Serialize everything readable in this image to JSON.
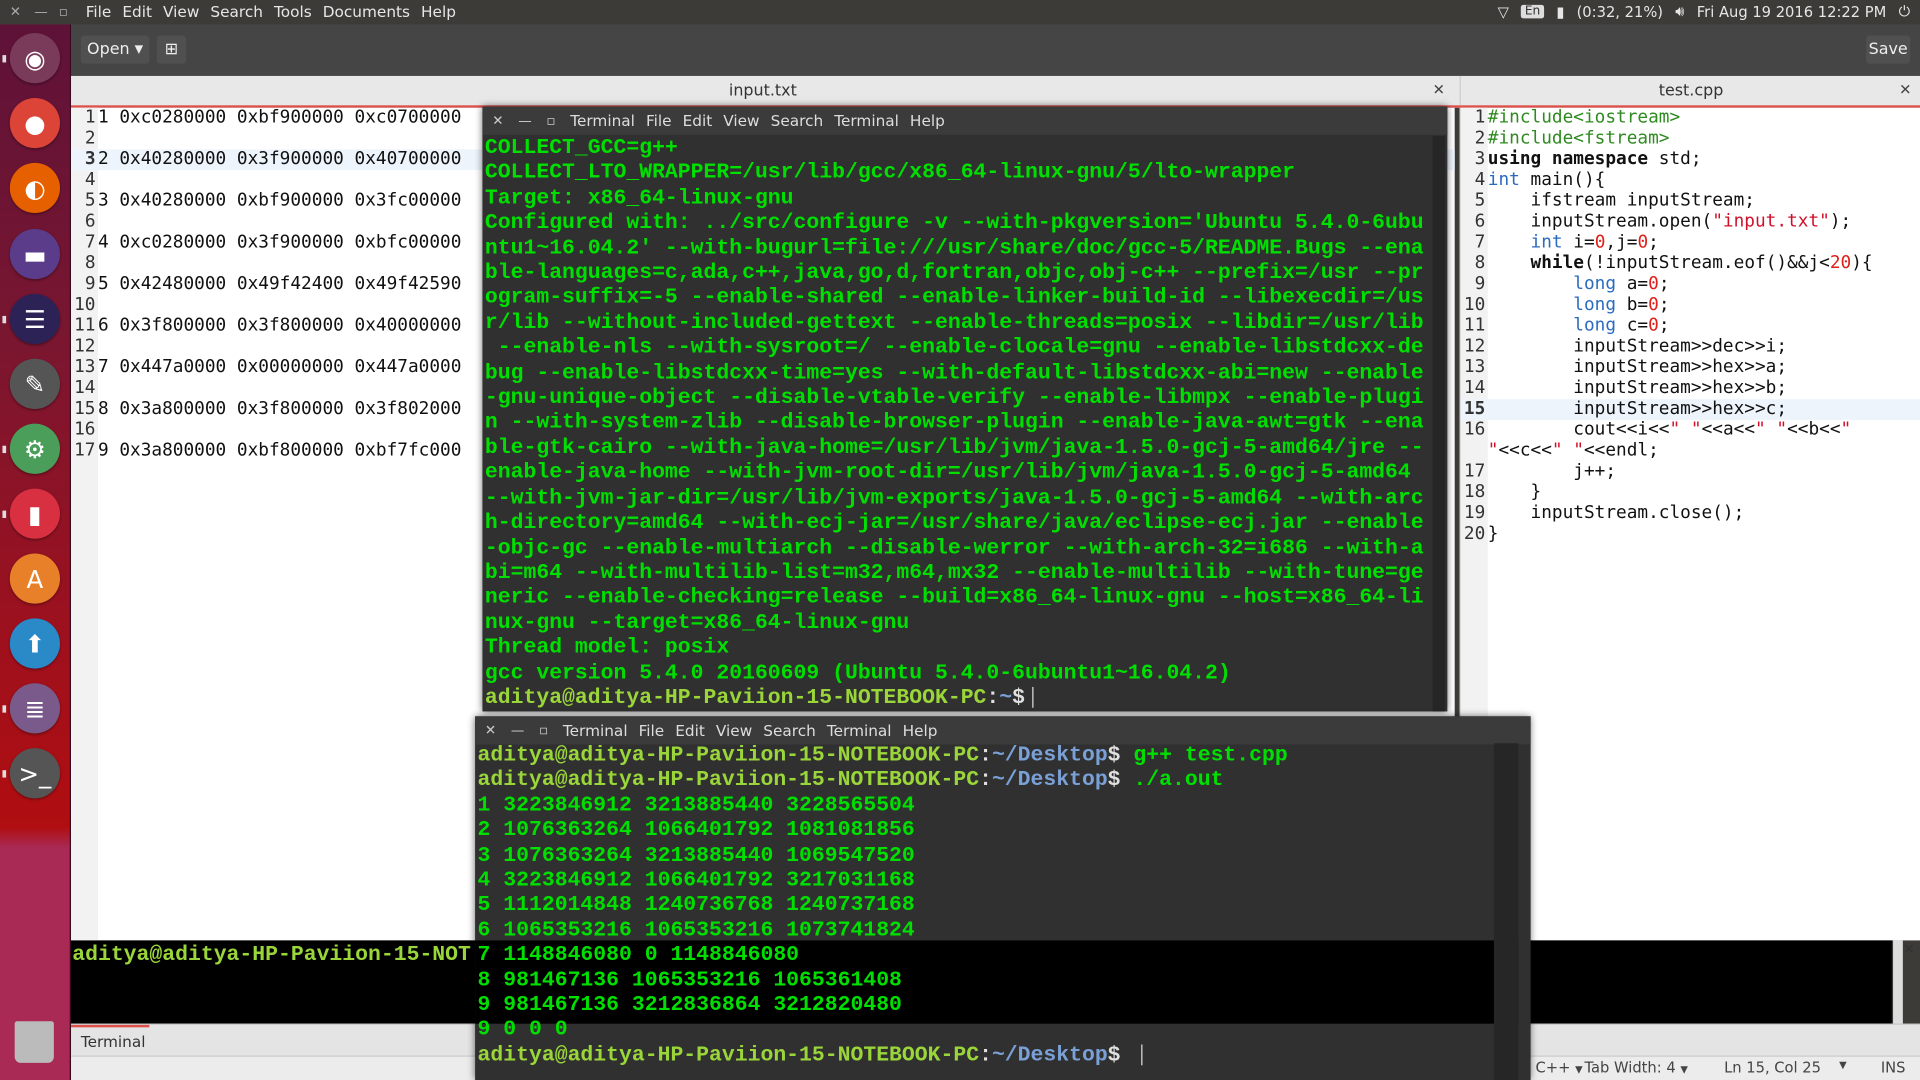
{
  "topbar": {
    "menu": [
      "File",
      "Edit",
      "View",
      "Search",
      "Tools",
      "Documents",
      "Help"
    ],
    "keyboard": "En",
    "battery": "(0:32, 21%)",
    "datetime": "Fri Aug 19 2016 12:22 PM",
    "icons": [
      "wifi-icon",
      "keyboard-icon",
      "battery-icon",
      "volume-icon",
      "power-icon"
    ]
  },
  "launcher": {
    "apps": [
      {
        "name": "ubuntu-dash",
        "glyph": "◉",
        "color": "#7a3a5a"
      },
      {
        "name": "chrome",
        "glyph": "●",
        "color": "#db4437"
      },
      {
        "name": "firefox",
        "glyph": "◐",
        "color": "#e66000"
      },
      {
        "name": "files",
        "glyph": "▬",
        "color": "#5a3c8a"
      },
      {
        "name": "eclipse",
        "glyph": "☰",
        "color": "#2c2255"
      },
      {
        "name": "wireshark",
        "glyph": "✎",
        "color": "#555"
      },
      {
        "name": "settings",
        "glyph": "⚙",
        "color": "#4a9e5a"
      },
      {
        "name": "app",
        "glyph": "▮",
        "color": "#d83040"
      },
      {
        "name": "software-center",
        "glyph": "A",
        "color": "#e8802a"
      },
      {
        "name": "software-updater",
        "glyph": "⬆",
        "color": "#2a8ac8"
      },
      {
        "name": "text-editor",
        "glyph": "≣",
        "color": "#7a5a8a"
      },
      {
        "name": "terminal",
        "glyph": ">_",
        "color": "#555"
      }
    ],
    "trash": "trash"
  },
  "toolbar": {
    "open_label": "Open",
    "save_label": "Save"
  },
  "tabs": [
    {
      "label": "input.txt"
    },
    {
      "label": "test.cpp"
    }
  ],
  "input_txt": {
    "current_line": 3,
    "lines": [
      "1 0xc0280000 0xbf900000 0xc0700000",
      "",
      "2 0x40280000 0x3f900000 0x40700000",
      "",
      "3 0x40280000 0xbf900000 0x3fc00000",
      "",
      "4 0xc0280000 0x3f900000 0xbfc00000",
      "",
      "5 0x42480000 0x49f42400 0x49f42590",
      "",
      "6 0x3f800000 0x3f800000 0x40000000",
      "",
      "7 0x447a0000 0x00000000 0x447a0000",
      "",
      "8 0x3a800000 0x3f800000 0x3f802000",
      "",
      "9 0x3a800000 0xbf800000 0xbf7fc000"
    ]
  },
  "test_cpp": {
    "current_line": 15,
    "lines": [
      {
        "n": "1",
        "t": [
          [
            "#include<iostream>",
            "pre"
          ]
        ]
      },
      {
        "n": "2",
        "t": [
          [
            "#include<fstream>",
            "pre"
          ]
        ]
      },
      {
        "n": "3",
        "t": [
          [
            "using namespace",
            "kw"
          ],
          [
            " std;",
            "plain"
          ]
        ]
      },
      {
        "n": "4",
        "t": [
          [
            "int",
            "type"
          ],
          [
            " main(){",
            "plain"
          ]
        ]
      },
      {
        "n": "5",
        "t": [
          [
            "    ifstream inputStream;",
            "plain"
          ]
        ]
      },
      {
        "n": "6",
        "t": [
          [
            "    inputStream.open(",
            "plain"
          ],
          [
            "\"input.txt\"",
            "str"
          ],
          [
            ");",
            "plain"
          ]
        ]
      },
      {
        "n": "7",
        "t": [
          [
            "    ",
            "plain"
          ],
          [
            "int",
            "type"
          ],
          [
            " i=",
            "plain"
          ],
          [
            "0",
            "num"
          ],
          [
            ",j=",
            "plain"
          ],
          [
            "0",
            "num"
          ],
          [
            ";",
            "plain"
          ]
        ]
      },
      {
        "n": "8",
        "t": [
          [
            "    ",
            "plain"
          ],
          [
            "while",
            "kw"
          ],
          [
            "(!inputStream.eof()&&j<",
            "plain"
          ],
          [
            "20",
            "num"
          ],
          [
            "){",
            "plain"
          ]
        ]
      },
      {
        "n": "9",
        "t": [
          [
            "        ",
            "plain"
          ],
          [
            "long",
            "type"
          ],
          [
            " a=",
            "plain"
          ],
          [
            "0",
            "num"
          ],
          [
            ";",
            "plain"
          ]
        ]
      },
      {
        "n": "10",
        "t": [
          [
            "        ",
            "plain"
          ],
          [
            "long",
            "type"
          ],
          [
            " b=",
            "plain"
          ],
          [
            "0",
            "num"
          ],
          [
            ";",
            "plain"
          ]
        ]
      },
      {
        "n": "11",
        "t": [
          [
            "        ",
            "plain"
          ],
          [
            "long",
            "type"
          ],
          [
            " c=",
            "plain"
          ],
          [
            "0",
            "num"
          ],
          [
            ";",
            "plain"
          ]
        ]
      },
      {
        "n": "12",
        "t": [
          [
            "        inputStream>>dec>>i;",
            "plain"
          ]
        ]
      },
      {
        "n": "13",
        "t": [
          [
            "        inputStream>>hex>>a;",
            "plain"
          ]
        ]
      },
      {
        "n": "14",
        "t": [
          [
            "        inputStream>>hex>>b;",
            "plain"
          ]
        ]
      },
      {
        "n": "15",
        "t": [
          [
            "        inputStream>>hex>>c;",
            "plain"
          ]
        ]
      },
      {
        "n": "16",
        "t": [
          [
            "        cout<<i<<",
            "plain"
          ],
          [
            "\" \"",
            "str"
          ],
          [
            "<<a<<",
            "plain"
          ],
          [
            "\" \"",
            "str"
          ],
          [
            "<<b<<",
            "plain"
          ],
          [
            "\"",
            "str"
          ]
        ]
      },
      {
        "n": "",
        "t": [
          [
            "\"",
            "str"
          ],
          [
            "<<c<<",
            "plain"
          ],
          [
            "\" \"",
            "str"
          ],
          [
            "<<endl;",
            "plain"
          ]
        ]
      },
      {
        "n": "17",
        "t": [
          [
            "        j++;",
            "plain"
          ]
        ]
      },
      {
        "n": "18",
        "t": [
          [
            "    }",
            "plain"
          ]
        ]
      },
      {
        "n": "19",
        "t": [
          [
            "    inputStream.close();",
            "plain"
          ]
        ]
      },
      {
        "n": "20",
        "t": [
          [
            "}",
            "plain"
          ]
        ]
      }
    ]
  },
  "terminal_menu": [
    "Terminal",
    "File",
    "Edit",
    "View",
    "Search",
    "Terminal",
    "Help"
  ],
  "terminal1": {
    "lines": [
      "COLLECT_GCC=g++",
      "COLLECT_LTO_WRAPPER=/usr/lib/gcc/x86_64-linux-gnu/5/lto-wrapper",
      "Target: x86_64-linux-gnu",
      "Configured with: ../src/configure -v --with-pkgversion='Ubuntu 5.4.0-6ubu",
      "ntu1~16.04.2' --with-bugurl=file:///usr/share/doc/gcc-5/README.Bugs --ena",
      "ble-languages=c,ada,c++,java,go,d,fortran,objc,obj-c++ --prefix=/usr --pr",
      "ogram-suffix=-5 --enable-shared --enable-linker-build-id --libexecdir=/us",
      "r/lib --without-included-gettext --enable-threads=posix --libdir=/usr/lib",
      " --enable-nls --with-sysroot=/ --enable-clocale=gnu --enable-libstdcxx-de",
      "bug --enable-libstdcxx-time=yes --with-default-libstdcxx-abi=new --enable",
      "-gnu-unique-object --disable-vtable-verify --enable-libmpx --enable-plugi",
      "n --with-system-zlib --disable-browser-plugin --enable-java-awt=gtk --ena",
      "ble-gtk-cairo --with-java-home=/usr/lib/jvm/java-1.5.0-gcj-5-amd64/jre --",
      "enable-java-home --with-jvm-root-dir=/usr/lib/jvm/java-1.5.0-gcj-5-amd64",
      "--with-jvm-jar-dir=/usr/lib/jvm-exports/java-1.5.0-gcj-5-amd64 --with-arc",
      "h-directory=amd64 --with-ecj-jar=/usr/share/java/eclipse-ecj.jar --enable",
      "-objc-gc --enable-multiarch --disable-werror --with-arch-32=i686 --with-a",
      "bi=m64 --with-multilib-list=m32,m64,mx32 --enable-multilib --with-tune=ge",
      "neric --enable-checking=release --build=x86_64-linux-gnu --host=x86_64-li",
      "nux-gnu --target=x86_64-linux-gnu",
      "Thread model: posix",
      "gcc version 5.4.0 20160609 (Ubuntu 5.4.0-6ubuntu1~16.04.2)"
    ],
    "prompt": {
      "user": "aditya@aditya-HP-Paviion-15-NOTEBOOK-PC",
      "path": "~",
      "cmd": ""
    }
  },
  "terminal2": {
    "lines": [
      {
        "prompt": true,
        "user": "aditya@aditya-HP-Paviion-15-NOTEBOOK-PC",
        "path": "~/Desktop",
        "cmd": " g++ test.cpp"
      },
      {
        "prompt": true,
        "user": "aditya@aditya-HP-Paviion-15-NOTEBOOK-PC",
        "path": "~/Desktop",
        "cmd": " ./a.out"
      },
      {
        "text": "1 3223846912 3213885440 3228565504"
      },
      {
        "text": "2 1076363264 1066401792 1081081856"
      },
      {
        "text": "3 1076363264 3213885440 1069547520"
      },
      {
        "text": "4 3223846912 1066401792 3217031168"
      },
      {
        "text": "5 1112014848 1240736768 1240737168"
      },
      {
        "text": "6 1065353216 1065353216 1073741824"
      },
      {
        "text": "7 1148846080 0 1148846080"
      },
      {
        "text": "8 981467136 1065353216 1065361408"
      },
      {
        "text": "9 981467136 3212836864 3212820480"
      },
      {
        "text": "9 0 0 0"
      },
      {
        "prompt": true,
        "user": "aditya@aditya-HP-Paviion-15-NOTEBOOK-PC",
        "path": "~/Desktop",
        "cmd": " "
      }
    ]
  },
  "bottom_panel": {
    "prompt_text": "aditya@aditya-HP-Paviion-15-NOT",
    "tab_label": "Terminal"
  },
  "statusbar": {
    "language": "C++",
    "tab_width": "Tab Width: 4",
    "position": "Ln 15, Col 25",
    "mode": "INS"
  },
  "colors": {
    "terminal_text": "#00e000",
    "prompt_user": "#9ad63a",
    "prompt_path": "#7aa0d8",
    "accent": "#e0504a"
  }
}
